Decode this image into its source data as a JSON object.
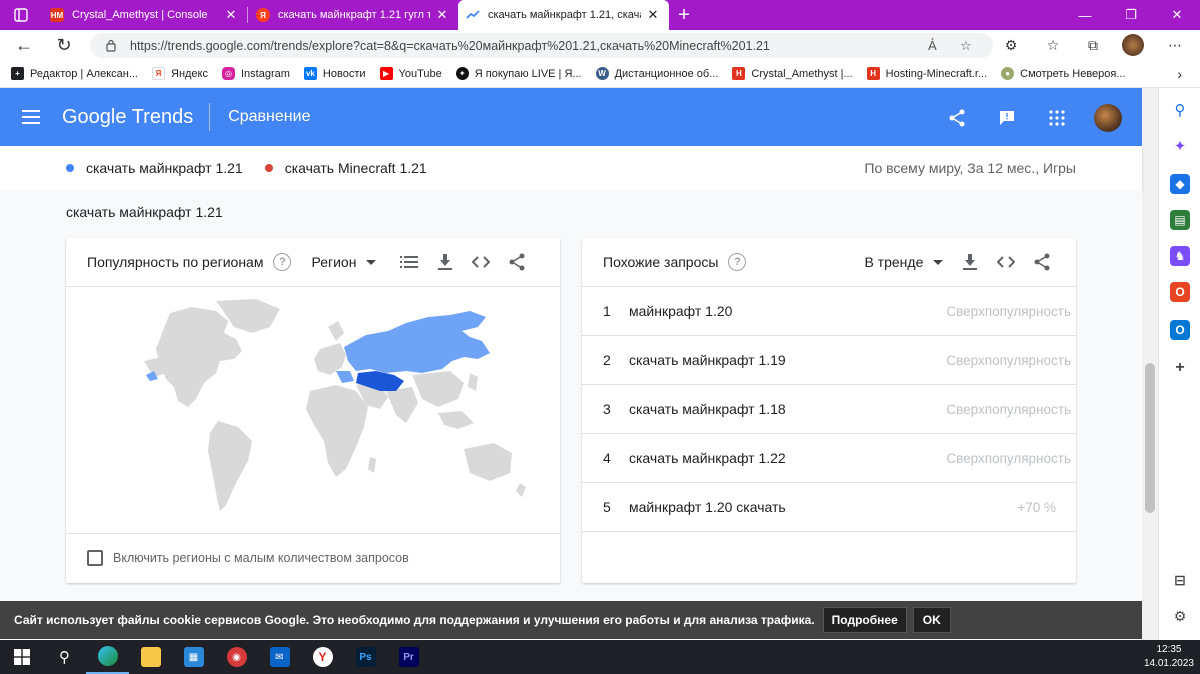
{
  "browser": {
    "tabs": [
      {
        "title": "Crystal_Amethyst | Console",
        "icon": "hostinger-icon",
        "active": false
      },
      {
        "title": "скачать майнкрафт 1.21 гугл тр",
        "icon": "yandex-icon",
        "active": false
      },
      {
        "title": "скачать майнкрафт 1.21, скачать",
        "icon": "trends-icon",
        "active": true
      }
    ],
    "url": "https://trends.google.com/trends/explore?cat=8&q=скачать%20майнкрафт%201.21,скачать%20Minecraft%201.21",
    "bookmarks": [
      {
        "label": "Редактор | Алексан...",
        "icon": "editor-icon",
        "color": "#202124"
      },
      {
        "label": "Яндекс",
        "icon": "yandex-icon",
        "color": "#ffffff"
      },
      {
        "label": "Instagram",
        "icon": "instagram-icon",
        "color": "#d6249f"
      },
      {
        "label": "Новости",
        "icon": "vk-icon",
        "color": "#0077ff"
      },
      {
        "label": "YouTube",
        "icon": "youtube-icon",
        "color": "#ff0000"
      },
      {
        "label": "Я покупаю LIVE | Я...",
        "icon": "live-icon",
        "color": "#111111"
      },
      {
        "label": "Дистанционное об...",
        "icon": "wordpress-icon",
        "color": "#3a5b8a"
      },
      {
        "label": "Crystal_Amethyst |...",
        "icon": "hostinger-icon",
        "color": "#e2351f"
      },
      {
        "label": "Hosting-Minecraft.r...",
        "icon": "hostinger-icon",
        "color": "#e2351f"
      },
      {
        "label": "Смотреть Неверoя...",
        "icon": "movie-icon",
        "color": "#9aa86a"
      }
    ]
  },
  "trends": {
    "logo": "Google Trends",
    "page_title": "Сравнение",
    "terms": [
      {
        "label": "скачать майнкрафт 1.21",
        "color": "#4285f4"
      },
      {
        "label": "скачать Minecraft 1.21",
        "color": "#db4437"
      }
    ],
    "scope": "По всему миру, За 12 мес., Игры",
    "section_title": "скачать майнкрафт 1.21",
    "regions_card": {
      "title": "Популярность по регионам",
      "help": "?",
      "selector": "Регион",
      "checkbox_label": "Включить регионы с малым количеством запросов"
    },
    "related_card": {
      "title": "Похожие запросы",
      "help": "?",
      "selector": "В тренде",
      "rows": [
        {
          "rank": "1",
          "query": "майнкрафт 1.20",
          "value": "Сверхпопулярность"
        },
        {
          "rank": "2",
          "query": "скачать майнкрафт 1.19",
          "value": "Сверхпопулярность"
        },
        {
          "rank": "3",
          "query": "скачать майнкрафт 1.18",
          "value": "Сверхпопулярность"
        },
        {
          "rank": "4",
          "query": "скачать майнкрафт 1.22",
          "value": "Сверхпопулярность"
        },
        {
          "rank": "5",
          "query": "майнкрафт 1.20 скачать",
          "value": "+70 %"
        }
      ]
    }
  },
  "cookie": {
    "text": "Сайт использует файлы cookie сервисов Google. Это необходимо для поддержания и улучшения его работы и для анализа трафика.",
    "more": "Подробнее",
    "ok": "OK"
  },
  "taskbar": {
    "time": "12:35",
    "date": "14.01.2023"
  }
}
